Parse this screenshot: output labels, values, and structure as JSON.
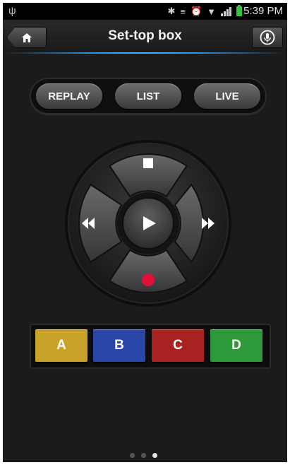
{
  "status_bar": {
    "time": "5:39 PM",
    "icons": [
      "usb-icon",
      "bluetooth-icon",
      "vibrate-icon",
      "alarm-icon",
      "wifi-icon",
      "signal-icon",
      "battery-icon"
    ]
  },
  "action_bar": {
    "title": "Set-top box",
    "home_icon": "home-icon",
    "mic_icon": "microphone-icon",
    "accent": "#2f8fd8"
  },
  "mode_buttons": [
    "REPLAY",
    "LIST",
    "LIVE"
  ],
  "dpad": {
    "up_icon": "stop-icon",
    "left_icon": "rewind-icon",
    "center_icon": "play-icon",
    "right_icon": "fast-forward-icon",
    "down_icon": "record-icon",
    "record_color": "#e0103a"
  },
  "color_keys": [
    {
      "label": "A",
      "color": "#c9a22a"
    },
    {
      "label": "B",
      "color": "#2a47a8"
    },
    {
      "label": "C",
      "color": "#a82222"
    },
    {
      "label": "D",
      "color": "#2c9a3a"
    }
  ],
  "page_indicator": {
    "total": 3,
    "current": 3
  }
}
